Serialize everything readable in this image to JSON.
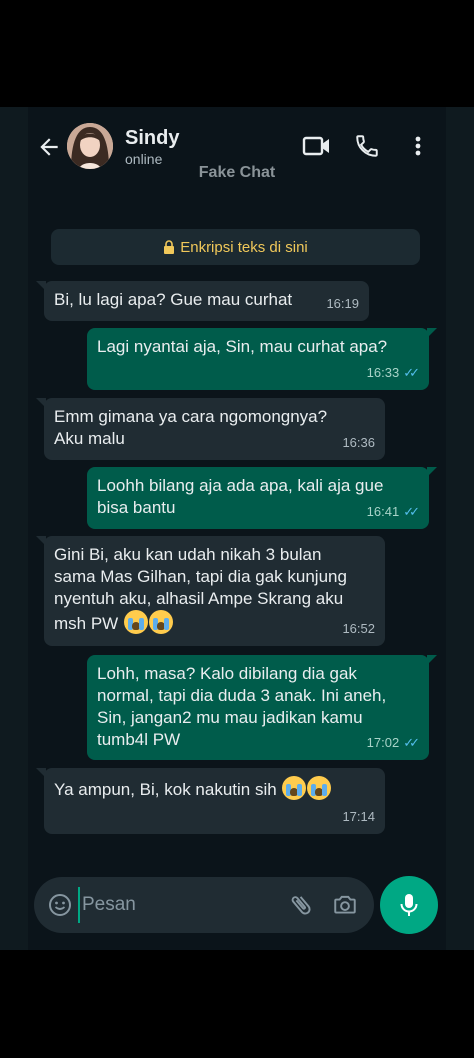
{
  "header": {
    "contact_name": "Sindy",
    "status": "online",
    "watermark": "Fake Chat",
    "icons": [
      "back-arrow-icon",
      "video-call-icon",
      "phone-icon",
      "more-vert-icon"
    ]
  },
  "encryption_notice": "Enkripsi teks di sini",
  "messages": [
    {
      "direction": "in",
      "text": "Bi, lu lagi apa? Gue mau curhat",
      "time": "16:19"
    },
    {
      "direction": "out",
      "text": "Lagi nyantai aja, Sin, mau curhat apa?",
      "time": "16:33",
      "read": true
    },
    {
      "direction": "in",
      "text": "Emm gimana ya cara ngomongnya?\nAku malu",
      "time": "16:36"
    },
    {
      "direction": "out",
      "text": "Loohh bilang aja ada apa, kali aja gue\nbisa bantu",
      "time": "16:41",
      "read": true
    },
    {
      "direction": "in",
      "text": "Gini Bi, aku kan udah nikah 3 bulan\nsama Mas Gilhan, tapi dia gak kunjung\nnyentuh aku, alhasil Ampe Skrang aku\nmsh PW",
      "emoji_count": 2,
      "time": "16:52"
    },
    {
      "direction": "out",
      "text": "Lohh, masa? Kalo dibilang dia gak\nnormal, tapi dia duda 3 anak. Ini aneh,\nSin, jangan2 mu mau jadikan kamu\ntumb4l PW",
      "time": "17:02",
      "read": true
    },
    {
      "direction": "in",
      "text": "Ya ampun, Bi, kok nakutin sih",
      "emoji_count": 2,
      "time": "17:14"
    }
  ],
  "composer": {
    "placeholder": "Pesan",
    "icons": [
      "emoji-icon",
      "attach-icon",
      "camera-icon",
      "mic-icon"
    ]
  },
  "colors": {
    "incoming_bubble": "#202c33",
    "outgoing_bubble": "#005c4b",
    "accent": "#00a884",
    "read_ticks": "#53bdeb"
  }
}
